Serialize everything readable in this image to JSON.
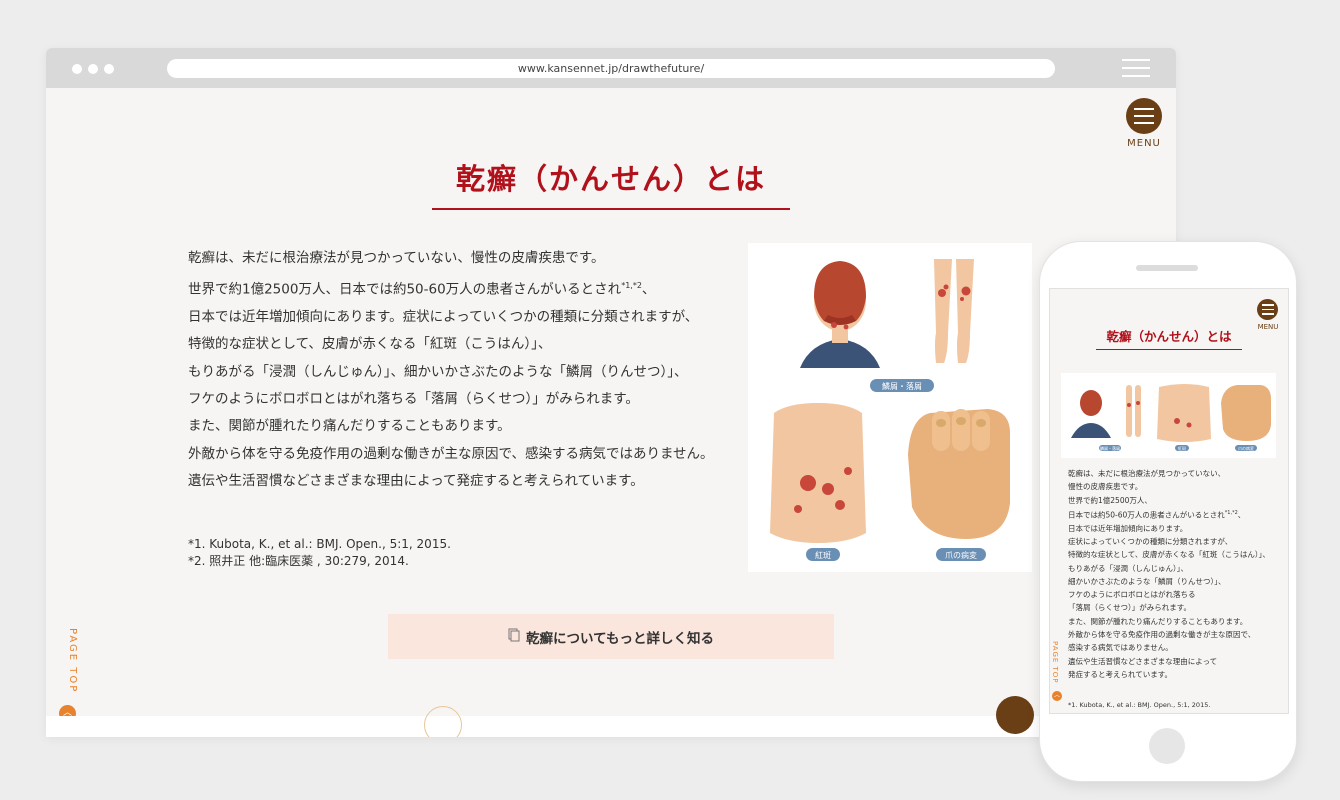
{
  "browser": {
    "url": "www.kansennet.jp/drawthefuture/"
  },
  "menu": {
    "label": "MENU"
  },
  "heading": "乾癬（かんせん）とは",
  "body": {
    "lines": [
      "乾癬は、未だに根治療法が見つかっていない、慢性の皮膚疾患です。",
      "世界で約1億2500万人、日本では約50-60万人の患者さんがいるとされ",
      "日本では近年増加傾向にあります。症状によっていくつかの種類に分類されますが、",
      "特徴的な症状として、皮膚が赤くなる「紅斑（こうはん）」、",
      "もりあがる「浸潤（しんじゅん）」、細かいかさぶたのような「鱗屑（りんせつ）」、",
      "フケのようにボロボロとはがれ落ちる「落屑（らくせつ）」がみられます。",
      "また、関節が腫れたり痛んだりすることもあります。",
      "外敵から体を守る免疫作用の過剰な働きが主な原因で、感染する病気ではありません。",
      "遺伝や生活習慣などさまざまな理由によって発症すると考えられています。"
    ],
    "sup": "*1,*2",
    "sup_tail": "、"
  },
  "references": [
    "*1. Kubota, K., et al.: BMJ. Open., 5:1, 2015.",
    "*2. 照井正 他:臨床医薬 , 30:279, 2014."
  ],
  "illustration_labels": {
    "scale": "鱗屑・落屑",
    "erythema": "紅斑",
    "nail": "爪の病変"
  },
  "cta": {
    "label": "乾癬についてもっと詳しく知る"
  },
  "page_top": "PAGE TOP",
  "mobile": {
    "heading": "乾癬（かんせん）とは",
    "menu_label": "MENU",
    "lines": [
      "乾癬は、未だに根治療法が見つかっていない、",
      "慢性の皮膚疾患です。",
      "世界で約1億2500万人、",
      "日本では約50-60万人の患者さんがいるとされ",
      "日本では近年増加傾向にあります。",
      "症状によっていくつかの種類に分類されますが、",
      "特徴的な症状として、皮膚が赤くなる「紅斑（こうはん）」、",
      "もりあがる「浸潤（しんじゅん）」、",
      "細かいかさぶたのような「鱗屑（りんせつ）」、",
      "フケのようにボロボロとはがれ落ちる",
      "「落屑（らくせつ）」がみられます。",
      "また、関節が腫れたり痛んだりすることもあります。",
      "外敵から体を守る免疫作用の過剰な働きが主な原因で、",
      "感染する病気ではありません。",
      "遺伝や生活習慣などさまざまな理由によって",
      "発症すると考えられています。"
    ],
    "sup": "*1,*2",
    "sup_tail": "、",
    "reference": "*1. Kubota, K., et al.: BMJ. Open., 5:1, 2015.",
    "page_top": "PAGE TOP",
    "illustration_labels": {
      "scale": "鱗屑・落屑",
      "erythema": "紅斑",
      "nail": "爪の病変"
    }
  },
  "colors": {
    "accent_red": "#b0111b",
    "brown": "#6b3f16",
    "orange": "#e8822c",
    "cta_bg": "#fbe6de"
  }
}
